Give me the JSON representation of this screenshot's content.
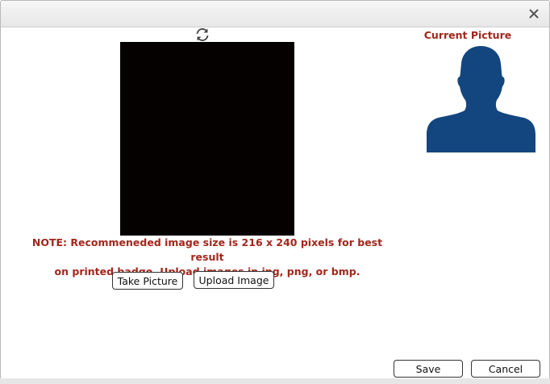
{
  "dialog": {
    "note_line1": "NOTE: Recommeneded image size is 216 x 240 pixels for best result",
    "note_line2": "on printed badge. Upload images in jpg, png, or bmp.",
    "current_picture_label": "Current Picture",
    "buttons": {
      "take_picture": "Take Picture",
      "upload_image": "Upload Image",
      "save": "Save",
      "cancel": "Cancel"
    }
  },
  "icons": {
    "close": "close-icon",
    "refresh": "refresh-icon",
    "avatar": "person-silhouette-icon"
  },
  "colors": {
    "accent_text": "#a1271c",
    "silhouette": "#13467f",
    "camera_bg": "#050101"
  }
}
